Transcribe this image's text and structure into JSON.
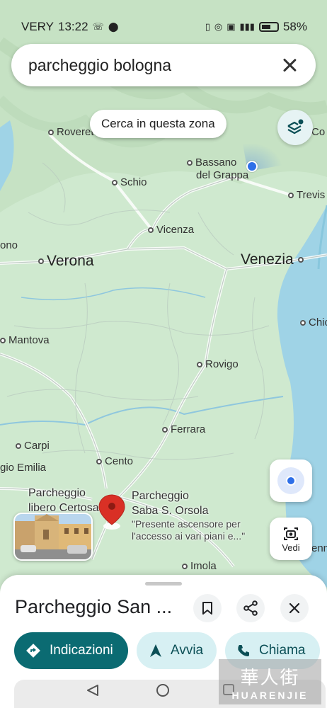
{
  "status_bar": {
    "carrier": "VERY",
    "time": "13:22",
    "battery": "58%"
  },
  "search": {
    "query": "parcheggio bologna"
  },
  "map": {
    "search_area_label": "Cerca in questa zona",
    "cities": {
      "rovereto": "Rovereto",
      "bassano": "Bassano",
      "del_grappa": "del Grappa",
      "schio": "Schio",
      "treviso": "Trevis",
      "vicenza": "Vicenza",
      "verona": "Verona",
      "venezia": "Venezia",
      "padova": "ono",
      "chioggia": "Chio",
      "mantova": "Mantova",
      "rovigo": "Rovigo",
      "ferrara": "Ferrara",
      "carpi": "Carpi",
      "cento": "Cento",
      "reggio": "gio Emilia",
      "imola": "Imola",
      "conegliano": "Co",
      "ravenna": "enn"
    },
    "parking_left": {
      "line1": "Parcheggio",
      "line2": "libero Certosa"
    },
    "parking_right": {
      "line1": "Parcheggio",
      "line2": "Saba S. Orsola",
      "desc1": "\"Presente ascensore per",
      "desc2": "l'accesso ai vari piani e...\""
    },
    "vedi_label": "Vedi"
  },
  "sheet": {
    "title": "Parcheggio San ...",
    "actions": {
      "directions": "Indicazioni",
      "start": "Avvia",
      "call": "Chiama"
    }
  },
  "watermark": {
    "big": "華人街",
    "small": "HUARENJIE"
  },
  "colors": {
    "primary": "#0b6b72",
    "secondary_bg": "#d7f0f3",
    "pin": "#d93025",
    "user_dot": "#2f6fe8",
    "water": "#9fd3e6"
  }
}
